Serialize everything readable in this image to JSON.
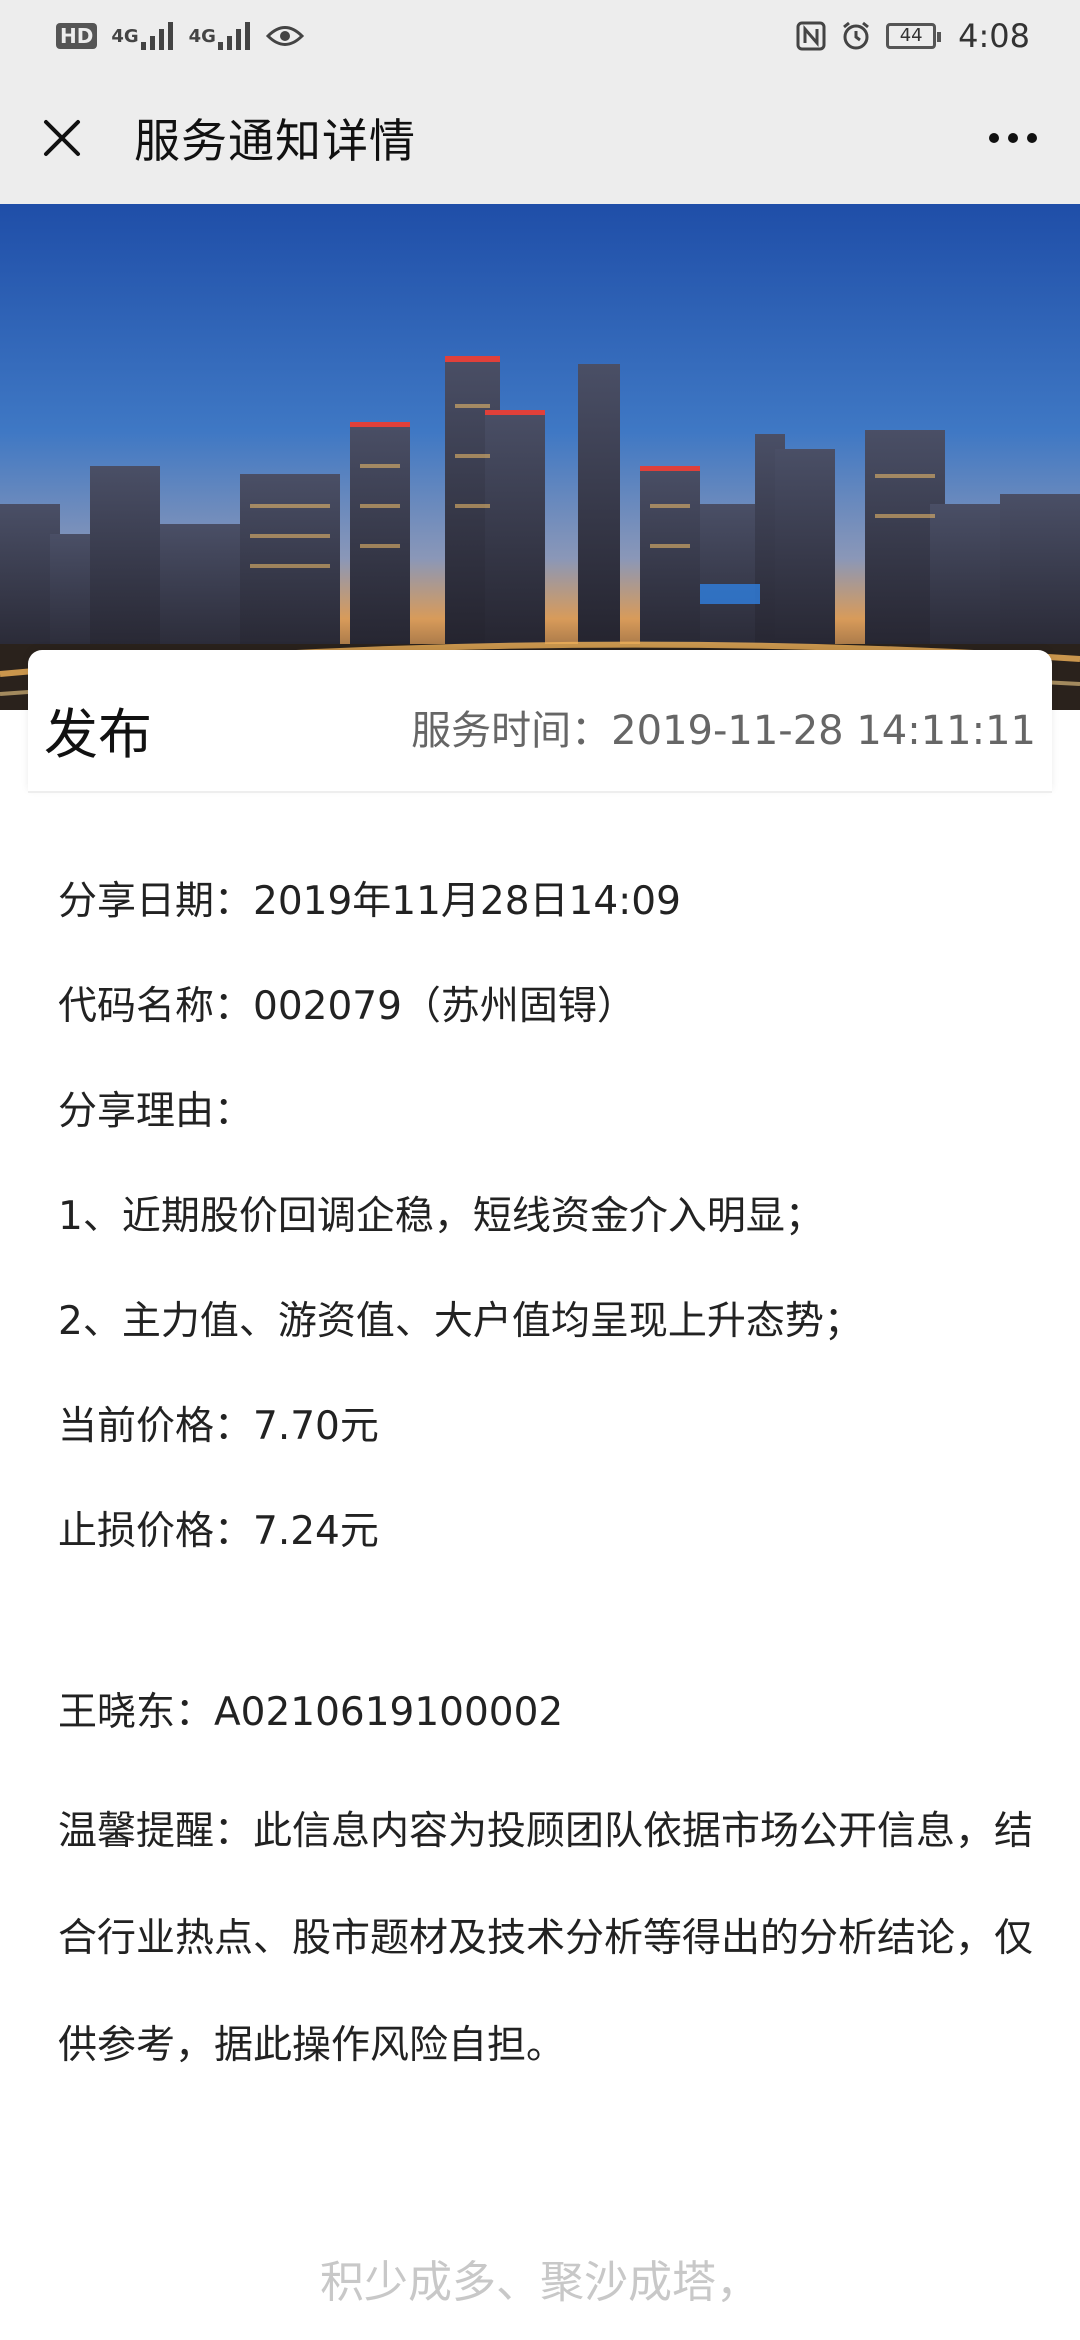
{
  "status_bar": {
    "hd_label": "HD",
    "sim1": "4G",
    "sim2": "4G",
    "battery": "44",
    "time": "4:08"
  },
  "header": {
    "title": "服务通知详情",
    "close_icon": "close-icon",
    "more_icon": "more-dots-icon"
  },
  "banner": {
    "image": "city-skyline-night-photo"
  },
  "card": {
    "title": "发布",
    "service_time": "服务时间：2019-11-28 14:11:11"
  },
  "content": {
    "share_date": "分享日期：2019年11月28日14:09",
    "code_name": "代码名称：002079（苏州固锝）",
    "reason_label": "分享理由：",
    "reason_1": "1、近期股价回调企稳，短线资金介入明显；",
    "reason_2": "2、主力值、游资值、大户值均呈现上升态势；",
    "current_price": "当前价格：7.70元",
    "stop_loss": "止损价格：7.24元",
    "advisor": "王晓东：A0210619100002",
    "reminder": "温馨提醒：此信息内容为投顾团队依据市场公开信息，结合行业热点、股市题材及技术分析等得出的分析结论，仅供参考，据此操作风险自担。"
  },
  "footer": {
    "text": "积少成多、聚沙成塔，"
  }
}
